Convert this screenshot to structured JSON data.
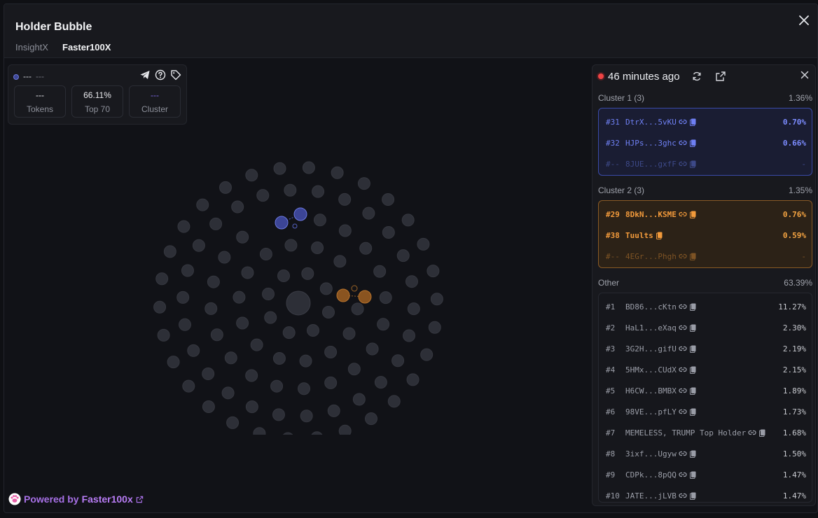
{
  "modal": {
    "title": "Holder Bubble",
    "tabs": [
      {
        "label": "InsightX",
        "active": false
      },
      {
        "label": "Faster100X",
        "active": true
      }
    ]
  },
  "stats": {
    "token_name": "---",
    "token_sub": "---",
    "boxes": [
      {
        "value": "---",
        "label": "Tokens"
      },
      {
        "value": "66.11%",
        "label": "Top 70"
      },
      {
        "value": "---",
        "label": "Cluster"
      }
    ],
    "icons": [
      "telegram-icon",
      "help-icon",
      "tag-icon"
    ]
  },
  "footer": {
    "powered_prefix": "Powered by",
    "powered_brand": "Faster100x"
  },
  "panel": {
    "time_ago": "46 minutes ago",
    "clusters": [
      {
        "label": "Cluster 1 (3)",
        "pct": "1.36%",
        "rows": [
          {
            "rank": "#31",
            "addr": "DtrX...5vKU",
            "pct": "0.70%"
          },
          {
            "rank": "#32",
            "addr": "HJPs...3ghc",
            "pct": "0.66%"
          },
          {
            "rank": "#--",
            "addr": "8JUE...gxfF",
            "pct": "-"
          }
        ]
      },
      {
        "label": "Cluster 2 (3)",
        "pct": "1.35%",
        "rows": [
          {
            "rank": "#29",
            "addr": "8DkN...KSME",
            "pct": "0.76%"
          },
          {
            "rank": "#38",
            "addr": "Tuults",
            "pct": "0.59%"
          },
          {
            "rank": "#--",
            "addr": "4EGr...Phgh",
            "pct": "-"
          }
        ]
      }
    ],
    "other": {
      "label": "Other",
      "pct": "63.39%",
      "rows": [
        {
          "rank": "#1",
          "addr": "BD86...cKtn",
          "pct": "11.27%"
        },
        {
          "rank": "#2",
          "addr": "HaL1...eXaq",
          "pct": "2.30%"
        },
        {
          "rank": "#3",
          "addr": "3G2H...gifU",
          "pct": "2.19%"
        },
        {
          "rank": "#4",
          "addr": "5HMx...CUdX",
          "pct": "2.15%"
        },
        {
          "rank": "#5",
          "addr": "H6CW...BMBX",
          "pct": "1.89%"
        },
        {
          "rank": "#6",
          "addr": "98VE...pfLY",
          "pct": "1.73%"
        },
        {
          "rank": "#7",
          "addr": "MEMELESS, TRUMP Top Holder",
          "pct": "1.68%"
        },
        {
          "rank": "#8",
          "addr": "3ixf...Ugyw",
          "pct": "1.50%"
        },
        {
          "rank": "#9",
          "addr": "CDPk...8pQQ",
          "pct": "1.47%"
        },
        {
          "rank": "#10",
          "addr": "JATE...jLVB",
          "pct": "1.47%"
        }
      ]
    }
  },
  "colors": {
    "cluster1": "#6f80f4",
    "cluster2": "#f29a3b",
    "bubble": "#2d2f37",
    "brand": "#b87cf5",
    "live": "#ef4444"
  }
}
